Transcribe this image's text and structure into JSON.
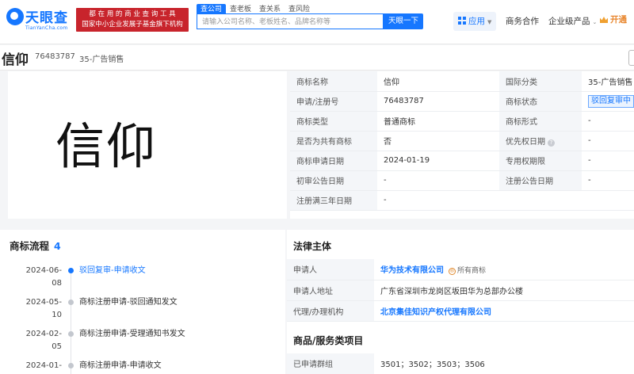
{
  "header": {
    "logo_text": "天眼查",
    "logo_sub": "TianYanCha.com",
    "banner_line1": "都 在 用 的 商 业 查 询 工 具",
    "banner_line2": "国家中小企业发展子基金旗下机构",
    "search_tabs": [
      "查公司",
      "查老板",
      "查关系",
      "查风险"
    ],
    "search_placeholder": "请输入公司名称、老板姓名、品牌名称等",
    "search_button": "天眼一下",
    "nav_app": "应用",
    "nav_business": "商务合作",
    "nav_enterprise": "企业级产品",
    "nav_vip": "开通"
  },
  "trademark": {
    "name": "信仰",
    "reg_no": "76483787",
    "class": "35-广告销售",
    "image_text": "信仰"
  },
  "info_rows": [
    {
      "k1": "商标名称",
      "v1": "信仰",
      "k2": "国际分类",
      "v2": "35-广告销售"
    },
    {
      "k1": "申请/注册号",
      "v1": "76483787",
      "k2": "商标状态",
      "v2": "驳回复审中"
    },
    {
      "k1": "商标类型",
      "v1": "普通商标",
      "k2": "商标形式",
      "v2": "-"
    },
    {
      "k1": "是否为共有商标",
      "v1": "否",
      "k2": "优先权日期",
      "v2": "-"
    },
    {
      "k1": "商标申请日期",
      "v1": "2024-01-19",
      "k2": "专用权期限",
      "v2": "-"
    },
    {
      "k1": "初审公告日期",
      "v1": "-",
      "k2": "注册公告日期",
      "v2": "-"
    },
    {
      "k1": "注册满三年日期",
      "v1": "-",
      "k2": "",
      "v2": ""
    }
  ],
  "flow": {
    "title": "商标流程",
    "count": "4",
    "items": [
      {
        "date_line1": "2024-06-",
        "date_line2": "08",
        "text": "驳回复审-申请收文",
        "active": true
      },
      {
        "date_line1": "2024-05-",
        "date_line2": "10",
        "text": "商标注册申请-驳回通知发文",
        "active": false
      },
      {
        "date_line1": "2024-02-",
        "date_line2": "05",
        "text": "商标注册申请-受理通知书发文",
        "active": false
      },
      {
        "date_line1": "2024-01-",
        "date_line2": "",
        "text": "商标注册申请-申请收文",
        "active": false
      }
    ]
  },
  "legal": {
    "title": "法律主体",
    "applicant_label": "申请人",
    "applicant_value": "华为技术有限公司",
    "owner_icon": "®",
    "owner_tag": "所有商标",
    "address_label": "申请人地址",
    "address_value": "广东省深圳市龙岗区坂田华为总部办公楼",
    "agent_label": "代理/办理机构",
    "agent_value": "北京集佳知识产权代理有限公司"
  },
  "goods": {
    "title": "商品/服务类项目",
    "group_label": "已申请群组",
    "group_value": "3501；3502；3503；3506"
  }
}
